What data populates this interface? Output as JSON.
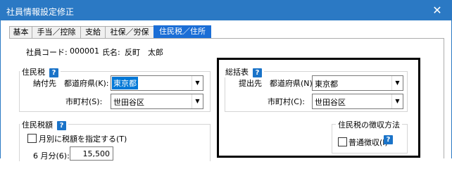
{
  "window": {
    "title": "社員情報設定修正",
    "close_glyph": "✕"
  },
  "tabs": [
    {
      "label": "基本"
    },
    {
      "label": "手当／控除"
    },
    {
      "label": "支給"
    },
    {
      "label": "社保／労保"
    },
    {
      "label": "住民税／住所"
    }
  ],
  "employee": {
    "code_label": "社員コード:",
    "code_value": "000001",
    "name_label": "氏名:",
    "name_value": "反町　太郎"
  },
  "jumin_zei": {
    "legend": "住民税",
    "help": "?",
    "nofusaki_label": "納付先　都道府県(K):",
    "prefecture_value": "東京都",
    "city_label": "市町村(S):",
    "city_value": "世田谷区"
  },
  "soukatsu": {
    "legend": "総括表",
    "help": "?",
    "teishutsu_label": "提出先　都道府県(N):",
    "prefecture_value": "東京都",
    "city_label": "市町村(C):",
    "city_value": "世田谷区"
  },
  "zeigaku": {
    "legend": "住民税額",
    "help": "?",
    "monthly_checkbox_label": "月別に税額を指定する(T)",
    "june_label": "6 月分(6):",
    "june_value": "15,500"
  },
  "chosyu": {
    "legend": "住民税の徴収方法",
    "futsu_label": "普通徴収(I)",
    "help": "?"
  },
  "dropdown_arrow": "▼"
}
